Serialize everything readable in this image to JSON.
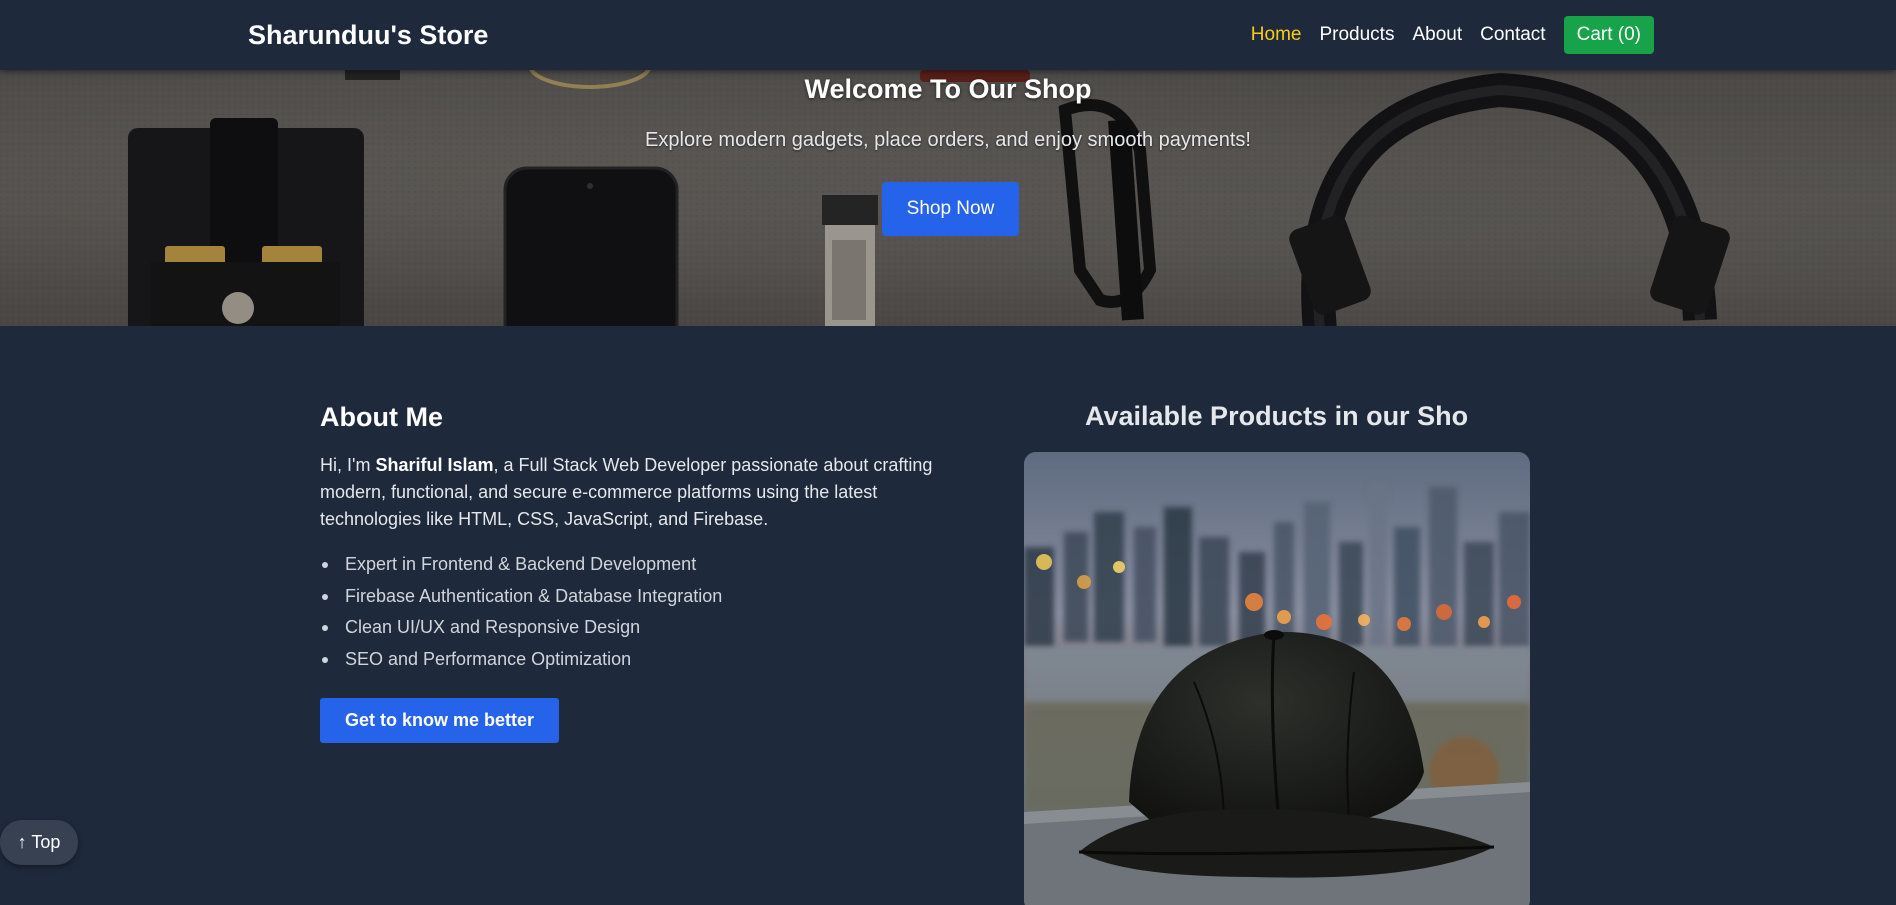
{
  "navbar": {
    "brand": "Sharunduu's Store",
    "links": [
      {
        "label": "Home",
        "active": true
      },
      {
        "label": "Products",
        "active": false
      },
      {
        "label": "About",
        "active": false
      },
      {
        "label": "Contact",
        "active": false
      }
    ],
    "cart_label": "Cart (0)"
  },
  "hero": {
    "title": "Welcome To Our Shop",
    "subtitle": "Explore modern gadgets, place orders, and enjoy smooth payments!",
    "button_label": "Shop Now"
  },
  "about": {
    "title": "About Me",
    "intro_before": "Hi, I'm ",
    "name": "Shariful Islam",
    "intro_after": ", a Full Stack Web Developer passionate about crafting modern, functional, and secure e-commerce platforms using the latest technologies like HTML, CSS, JavaScript, and Firebase.",
    "skills": [
      "Expert in Frontend & Backend Development",
      "Firebase Authentication & Database Integration",
      "Clean UI/UX and Responsive Design",
      "SEO and Performance Optimization"
    ],
    "button_label": "Get to know me better"
  },
  "products": {
    "title": "Available Products in our Shop"
  },
  "scroll_top": {
    "label": "↑ Top"
  },
  "colors": {
    "background": "#1e293b",
    "accent_blue": "#2563eb",
    "cart_green": "#16a34a",
    "active_link": "#facc15"
  }
}
